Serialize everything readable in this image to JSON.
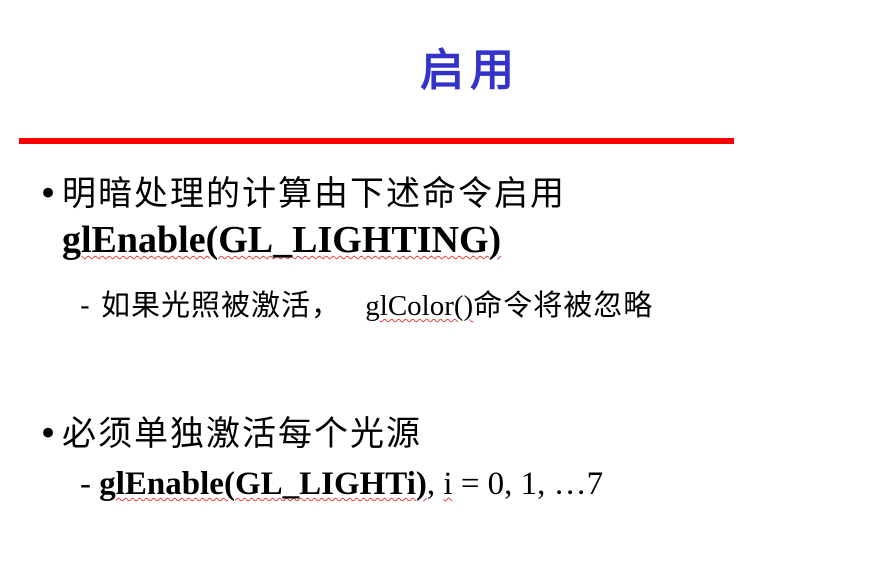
{
  "slide": {
    "title": "启用",
    "accent_color": "#ff0000",
    "title_color": "#3333cc",
    "bullets": [
      {
        "marker": "•",
        "text": "明暗处理的计算由下述命令启用",
        "code": "glEnable(GL_LIGHTING)",
        "sub": {
          "dash": "-",
          "text_before": "如果光照被激活，",
          "code": "glColor()",
          "text_after": "命令将被忽略"
        }
      },
      {
        "marker": "•",
        "text": "必须单独激活每个光源",
        "sub": {
          "dash": "-",
          "code": "glEnable(GL_LIGHTi)",
          "separator": ", ",
          "var": "i",
          "rest": " = 0, 1, …7"
        }
      }
    ]
  }
}
